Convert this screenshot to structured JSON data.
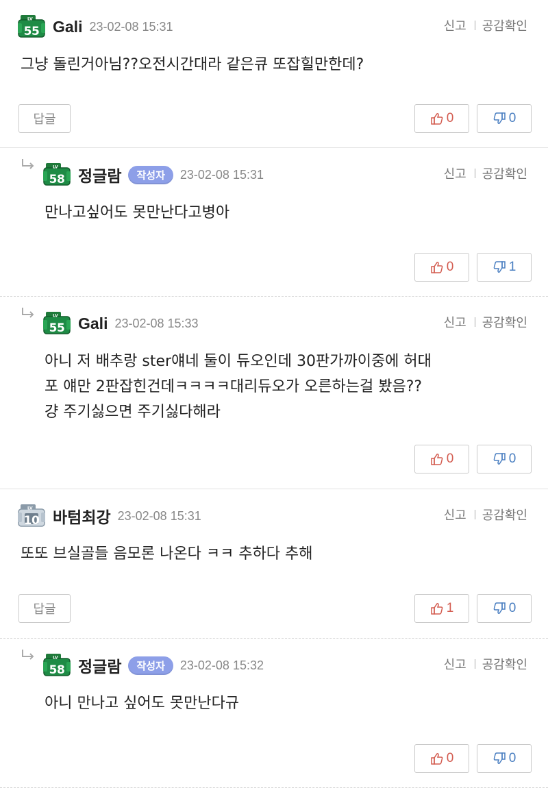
{
  "actions": {
    "report": "신고",
    "empathy": "공감확인"
  },
  "reply_button_label": "답글",
  "comments": [
    {
      "level": "55",
      "nickname": "Gali",
      "author_badge": "",
      "date": "23-02-08 15:31",
      "text": "그냥 돌린거아님??오전시간대라 같은큐 또잡힐만한데?",
      "likes": "0",
      "dislikes": "0"
    },
    {
      "level": "58",
      "nickname": "정글람",
      "author_badge": "작성자",
      "date": "23-02-08 15:31",
      "text": "만나고싶어도 못만난다고병아",
      "likes": "0",
      "dislikes": "1"
    },
    {
      "level": "55",
      "nickname": "Gali",
      "author_badge": "",
      "date": "23-02-08 15:33",
      "text": "아니 저 배추랑 ster얘네 둘이 듀오인데 30판가까이중에 허대\n포 얘만 2판잡힌건데ㅋㅋㅋㅋ대리듀오가 오른하는걸 봤음??\n걍 주기싫으면 주기싫다해라",
      "likes": "0",
      "dislikes": "0"
    },
    {
      "level": "10",
      "nickname": "바텀최강",
      "author_badge": "",
      "date": "23-02-08 15:31",
      "text": "또또 브실골들 음모론 나온다 ㅋㅋ 추하다 추해",
      "likes": "1",
      "dislikes": "0"
    },
    {
      "level": "58",
      "nickname": "정글람",
      "author_badge": "작성자",
      "date": "23-02-08 15:32",
      "text": "아니 만나고 싶어도 못만난다규",
      "likes": "0",
      "dislikes": "0"
    }
  ]
}
